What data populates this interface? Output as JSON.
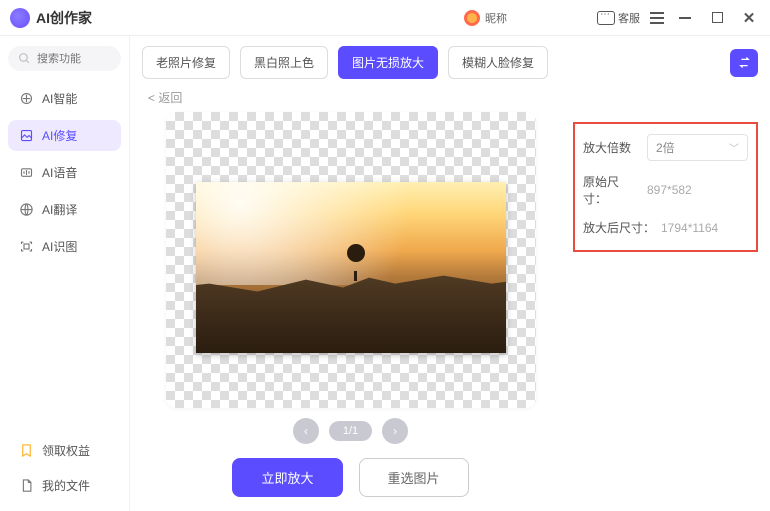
{
  "app": {
    "title": "AI创作家"
  },
  "titlebar": {
    "nickname": "昵称",
    "kefu": "客服"
  },
  "search": {
    "placeholder": "搜索功能"
  },
  "sidebar": {
    "items": [
      {
        "label": "AI智能"
      },
      {
        "label": "AI修复"
      },
      {
        "label": "AI语音"
      },
      {
        "label": "AI翻译"
      },
      {
        "label": "AI识图"
      }
    ],
    "bottom": [
      {
        "label": "领取权益"
      },
      {
        "label": "我的文件"
      }
    ]
  },
  "tabs": {
    "items": [
      {
        "label": "老照片修复"
      },
      {
        "label": "黑白照上色"
      },
      {
        "label": "图片无损放大"
      },
      {
        "label": "模糊人脸修复"
      }
    ],
    "active_index": 2
  },
  "back": {
    "label": "<  返回"
  },
  "pager": {
    "text": "1/1"
  },
  "actions": {
    "primary": "立即放大",
    "secondary": "重选图片"
  },
  "panel": {
    "scale_label": "放大倍数",
    "scale_value": "2倍",
    "orig_label": "原始尺寸：",
    "orig_value": "897*582",
    "after_label": "放大后尺寸：",
    "after_value": "1794*1164"
  },
  "colors": {
    "accent": "#5b4dff",
    "highlight": "#e74c3c"
  }
}
